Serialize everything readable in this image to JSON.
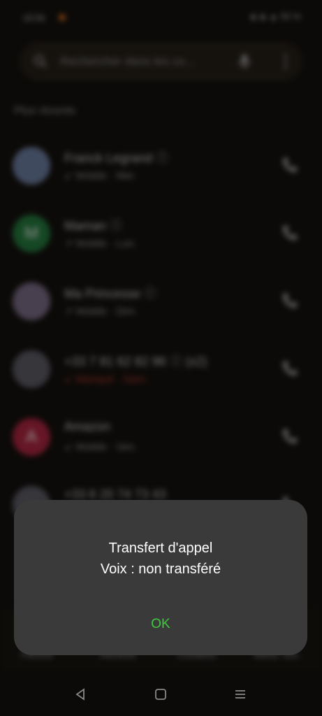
{
  "status_bar": {
    "time": "18:56",
    "right": "◈ ◈ ▲ 55 %"
  },
  "search": {
    "placeholder": "Rechercher dans les co..."
  },
  "recents": {
    "section_title": "Plus récents",
    "calls": [
      {
        "name": "Franck Legrand ⓘ",
        "detail": "↙ Mobile · Mer.",
        "missed": false,
        "avatar_color": "#6b7fa6",
        "avatar_letter": ""
      },
      {
        "name": "Maman ⓘ",
        "detail": "↗ Mobile · Lun.",
        "missed": false,
        "avatar_color": "#1e7a3c",
        "avatar_letter": "M"
      },
      {
        "name": "Ma Princesse ⓘ",
        "detail": "↗ Mobile · Dim.",
        "missed": false,
        "avatar_color": "#7a6c8a",
        "avatar_letter": ""
      },
      {
        "name": "+33 7 81 62 82 96 ⓘ (x2)",
        "detail": "↙ Manqué · Sam.",
        "missed": true,
        "avatar_color": "#5a5a66",
        "avatar_letter": ""
      },
      {
        "name": "Amazon",
        "detail": "↙ Mobile · Ven.",
        "missed": false,
        "avatar_color": "#b0213f",
        "avatar_letter": "A"
      },
      {
        "name": "+33 6 20 74 73 43",
        "detail": "",
        "missed": false,
        "avatar_color": "#5a5a66",
        "avatar_letter": ""
      }
    ]
  },
  "bottom_nav": {
    "favorites": "Favoris",
    "recents": "Récents",
    "contacts": "Contacts",
    "voicemail": "Mess. voc."
  },
  "dialog": {
    "title": "Transfert d'appel",
    "message": "Voix : non transféré",
    "ok_label": "OK"
  },
  "colors": {
    "accent": "#3ec93e",
    "dialog_bg": "#3a3a3a",
    "missed": "#c0392b"
  }
}
